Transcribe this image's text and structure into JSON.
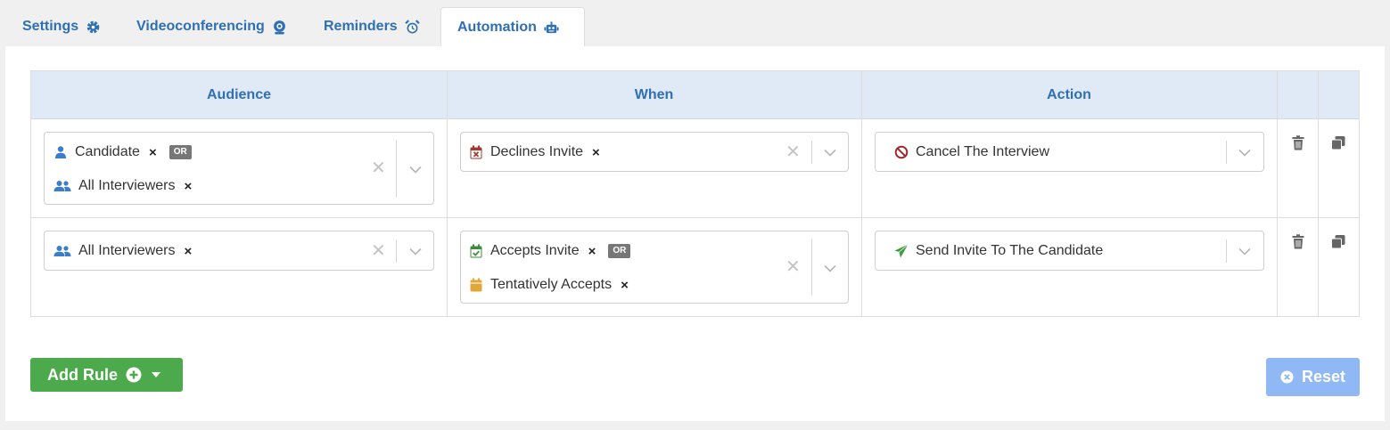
{
  "tabs": [
    {
      "label": "Settings",
      "icon": "gear-icon"
    },
    {
      "label": "Videoconferencing",
      "icon": "webcam-icon"
    },
    {
      "label": "Reminders",
      "icon": "alarm-clock-icon"
    },
    {
      "label": "Automation",
      "icon": "robot-icon",
      "active": true
    }
  ],
  "table": {
    "headers": [
      "Audience",
      "When",
      "Action"
    ],
    "rows": [
      {
        "audience": [
          {
            "label": "Candidate",
            "icon": "user-icon",
            "or": "OR"
          },
          {
            "label": "All Interviewers",
            "icon": "users-icon"
          }
        ],
        "when": [
          {
            "label": "Declines Invite",
            "icon": "calendar-x-icon",
            "color": "#a33a2f"
          }
        ],
        "action": {
          "label": "Cancel The Interview",
          "icon": "ban-icon",
          "color": "#a02a2a"
        }
      },
      {
        "audience": [
          {
            "label": "All Interviewers",
            "icon": "users-icon"
          }
        ],
        "when": [
          {
            "label": "Accepts Invite",
            "icon": "calendar-check-icon",
            "color": "#3b8d3b",
            "or": "OR"
          },
          {
            "label": "Tentatively Accepts",
            "icon": "calendar-icon",
            "color": "#e0a83a"
          }
        ],
        "action": {
          "label": "Send Invite To The Candidate",
          "icon": "paper-plane-icon",
          "color": "#3f9a3f"
        }
      }
    ]
  },
  "chip_remove": "×",
  "clear_symbol": "✕",
  "buttons": {
    "add_rule": "Add Rule",
    "reset": "Reset"
  },
  "colors": {
    "accent": "#2f6fb3",
    "header_bg": "#dfeaf6",
    "add_button": "#4caa4c",
    "reset_button": "#8fb8f5"
  }
}
